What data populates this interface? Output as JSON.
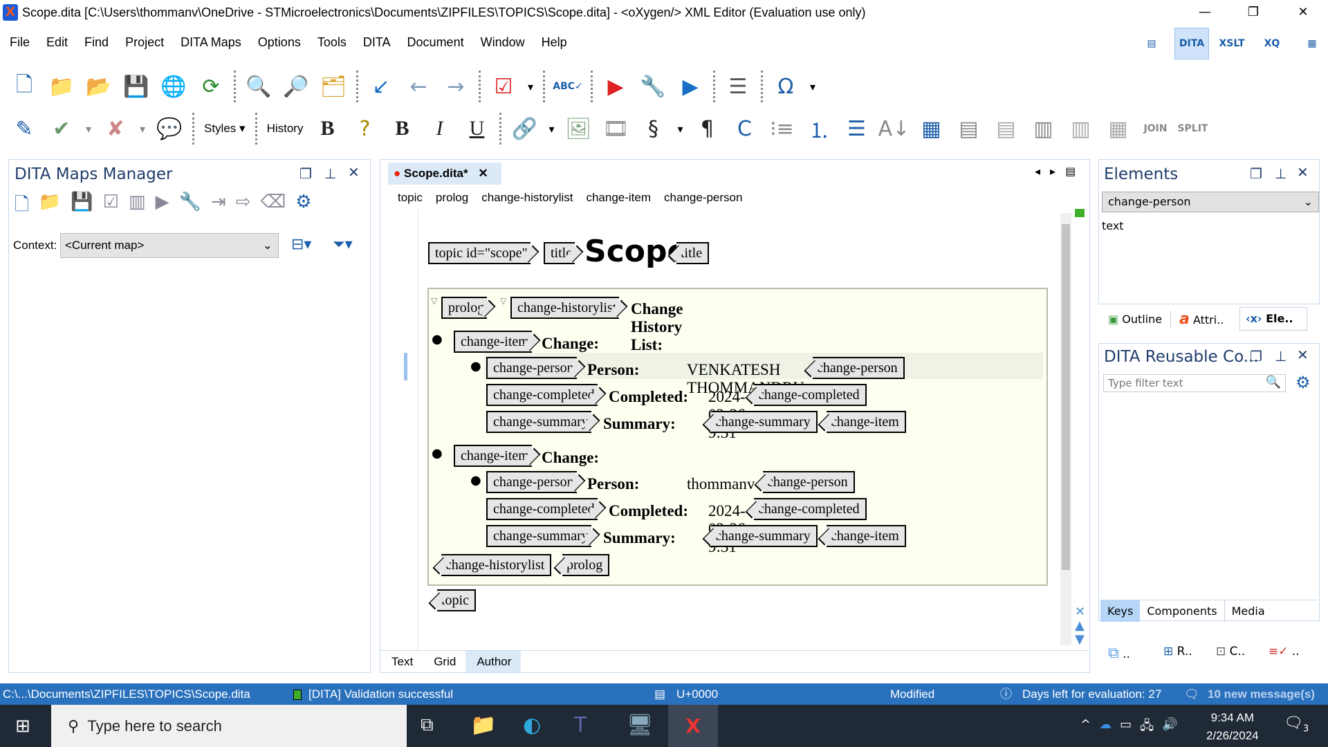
{
  "window": {
    "title": "Scope.dita [C:\\Users\\thommanv\\OneDrive - STMicroelectronics\\Documents\\ZIPFILES\\TOPICS\\Scope.dita] - <oXygen/> XML Editor (Evaluation use only)",
    "minimize": "—",
    "restore": "❐",
    "close": "✕"
  },
  "menu": [
    "File",
    "Edit",
    "Find",
    "Project",
    "DITA Maps",
    "Options",
    "Tools",
    "DITA",
    "Document",
    "Window",
    "Help"
  ],
  "perspectives": [
    {
      "name": "editor-perspective-icon",
      "glyph": "▤"
    },
    {
      "name": "dita-perspective-icon",
      "glyph": "DITA"
    },
    {
      "name": "xslt-debugger-icon",
      "glyph": "XSLT"
    },
    {
      "name": "xquery-debugger-icon",
      "glyph": "XQ"
    },
    {
      "name": "database-perspective-icon",
      "glyph": "▦"
    }
  ],
  "toolbar1": [
    {
      "name": "new-file-icon",
      "glyph": "🗋",
      "color": "#1a5da8"
    },
    {
      "name": "open-folder-icon",
      "glyph": "📁",
      "color": "#d9a22a"
    },
    {
      "name": "open-url-icon",
      "glyph": "📂",
      "color": "#d9a22a"
    },
    {
      "name": "save-icon",
      "glyph": "💾",
      "color": "#1a5da8"
    },
    {
      "name": "save-to-url-icon",
      "glyph": "🌐",
      "color": "#1a5da8"
    },
    {
      "name": "reload-icon",
      "glyph": "⟳",
      "color": "#2a8a2a"
    },
    {
      "sep": true
    },
    {
      "name": "find-icon",
      "glyph": "🔍",
      "color": "#1a5da8"
    },
    {
      "name": "find-in-files-icon",
      "glyph": "🔎",
      "color": "#1a5da8"
    },
    {
      "name": "open-file-folder-icon",
      "glyph": "🗂",
      "color": "#d9a22a"
    },
    {
      "sep": true
    },
    {
      "name": "last-edit-icon",
      "glyph": "↙",
      "color": "#1a6fc4"
    },
    {
      "name": "back-icon",
      "glyph": "←",
      "color": "#7f9ab8"
    },
    {
      "name": "forward-icon",
      "glyph": "→",
      "color": "#7f9ab8"
    },
    {
      "sep": true
    },
    {
      "name": "validate-icon",
      "glyph": "☑",
      "color": "#d22"
    },
    {
      "name": "dropdown-arrow-icon",
      "glyph": "▾",
      "color": "#000"
    },
    {
      "sep": true
    },
    {
      "name": "spell-check-icon",
      "glyph": "ABC✓",
      "color": "#1a5da8"
    },
    {
      "sep": true
    },
    {
      "name": "apply-transformation-icon",
      "glyph": "▶",
      "color": "#d22"
    },
    {
      "name": "configure-transformation-icon",
      "glyph": "🔧",
      "color": "#555"
    },
    {
      "name": "debug-transformation-icon",
      "glyph": "▶",
      "color": "#1a6fc4"
    },
    {
      "sep": true
    },
    {
      "name": "format-indent-icon",
      "glyph": "☰",
      "color": "#555"
    },
    {
      "sep": true
    },
    {
      "name": "insert-special-char-icon",
      "glyph": "Ω",
      "color": "#1a5da8"
    },
    {
      "name": "dropdown-arrow-icon",
      "glyph": "▾",
      "color": "#000"
    }
  ],
  "toolbar2": [
    {
      "name": "edit-attributes-icon",
      "glyph": "✎",
      "color": "#1a5da8"
    },
    {
      "name": "accept-change-icon",
      "glyph": "✔",
      "color": "#6a9a6a"
    },
    {
      "name": "dropdown-arrow-icon",
      "glyph": "▾",
      "color": "#888"
    },
    {
      "name": "reject-change-icon",
      "glyph": "✘",
      "color": "#c88"
    },
    {
      "name": "dropdown-arrow-icon",
      "glyph": "▾",
      "color": "#888"
    },
    {
      "name": "comment-icon",
      "glyph": "💬",
      "color": "#99a"
    },
    {
      "sep": true
    },
    {
      "text": "Styles ▾",
      "name": "styles-button"
    },
    {
      "sep": true
    },
    {
      "text": "History",
      "name": "history-button"
    },
    {
      "name": "bold-icon",
      "glyph": "B",
      "color": "#222",
      "bold": true
    },
    {
      "name": "conditional-icon",
      "glyph": "?",
      "color": "#a80"
    },
    {
      "name": "bold-icon",
      "glyph": "B",
      "color": "#222",
      "bold": true
    },
    {
      "name": "italic-icon",
      "glyph": "I",
      "color": "#222",
      "italic": true
    },
    {
      "name": "underline-icon",
      "glyph": "U",
      "color": "#222",
      "underline": true
    },
    {
      "sep": true
    },
    {
      "name": "link-icon",
      "glyph": "🔗",
      "color": "#333"
    },
    {
      "name": "dropdown-arrow-icon",
      "glyph": "▾",
      "color": "#000"
    },
    {
      "name": "insert-image-icon",
      "glyph": "🖼",
      "color": "#8a8"
    },
    {
      "name": "insert-media-icon",
      "glyph": "🎞",
      "color": "#888"
    },
    {
      "name": "section-icon",
      "glyph": "§",
      "color": "#222"
    },
    {
      "name": "dropdown-arrow-icon",
      "glyph": "▾",
      "color": "#000"
    },
    {
      "name": "paragraph-icon",
      "glyph": "¶",
      "color": "#222"
    },
    {
      "name": "insert-conref-icon",
      "glyph": "C",
      "color": "#1a5da8"
    },
    {
      "name": "step-list-icon",
      "glyph": "⁝≡",
      "color": "#888"
    },
    {
      "name": "ordered-list-icon",
      "glyph": "⒈",
      "color": "#1a5da8"
    },
    {
      "name": "unordered-list-icon",
      "glyph": "☰",
      "color": "#1a5da8"
    },
    {
      "name": "sort-icon",
      "glyph": "A↓",
      "color": "#888"
    },
    {
      "name": "insert-table-icon",
      "glyph": "▦",
      "color": "#1a5da8"
    },
    {
      "name": "insert-row-icon",
      "glyph": "▤",
      "color": "#888"
    },
    {
      "name": "delete-row-icon",
      "glyph": "▤",
      "color": "#aaa"
    },
    {
      "name": "insert-column-icon",
      "glyph": "▥",
      "color": "#888"
    },
    {
      "name": "delete-column-icon",
      "glyph": "▥",
      "color": "#aaa"
    },
    {
      "name": "table-properties-icon",
      "glyph": "▦",
      "color": "#aaa"
    },
    {
      "name": "join-cells-icon",
      "glyph": "JOIN",
      "color": "#888"
    },
    {
      "name": "split-cell-icon",
      "glyph": "SPLIT",
      "color": "#888"
    }
  ],
  "maps_manager": {
    "title": "DITA Maps Manager",
    "context_label": "Context:",
    "context_value": "<Current map>"
  },
  "editor": {
    "tab": "Scope.dita*",
    "tab_close": "✕",
    "breadcrumbs": [
      "topic",
      "prolog",
      "change-historylist",
      "change-item",
      "change-person"
    ],
    "topic_tag": "topic id=\"scope\"",
    "title_tag": "title",
    "title": "Scope",
    "prolog_tag": "prolog",
    "historylist_tag": "change-historylist",
    "historylist_label": "Change History List:",
    "items": [
      {
        "item_tag": "change-item",
        "change_label": "Change:",
        "person_tag": "change-person",
        "person_label": "Person:",
        "person": "VENKATESH THOMMANDRU",
        "completed_tag": "change-completed",
        "completed_label": "Completed:",
        "completed": "2024-02-26 9:31",
        "summary_tag": "change-summary",
        "summary_label": "Summary:"
      },
      {
        "item_tag": "change-item",
        "change_label": "Change:",
        "person_tag": "change-person",
        "person_label": "Person:",
        "person": "thommanv",
        "completed_tag": "change-completed",
        "completed_label": "Completed:",
        "completed": "2024-02-26 9:31",
        "summary_tag": "change-summary",
        "summary_label": "Summary:"
      }
    ],
    "bottom_tabs": [
      "Text",
      "Grid",
      "Author"
    ],
    "active_bottom_tab": "Author"
  },
  "elements_panel": {
    "title": "Elements",
    "selected": "change-person",
    "items": [
      "text"
    ],
    "tabs": [
      "Outline",
      "Attri..",
      "Ele.."
    ]
  },
  "reusable_panel": {
    "title": "DITA Reusable Co...",
    "filter_placeholder": "Type filter text",
    "tabs": [
      "Keys",
      "Components",
      "Media"
    ],
    "bottom_tabs": [
      "..",
      "R..",
      "C..",
      ".."
    ]
  },
  "status": {
    "path": "C:\\...\\Documents\\ZIPFILES\\TOPICS\\Scope.dita",
    "validation": "[DITA] Validation successful",
    "unicode": "U+0000",
    "modified": "Modified",
    "evaluation": "Days left for evaluation: 27",
    "messages": "10 new message(s)",
    "validation_color": "#3fae2a"
  },
  "taskbar": {
    "search_placeholder": "Type here to search",
    "time": "9:34 AM",
    "date": "2/26/2024",
    "notifications": "3"
  }
}
